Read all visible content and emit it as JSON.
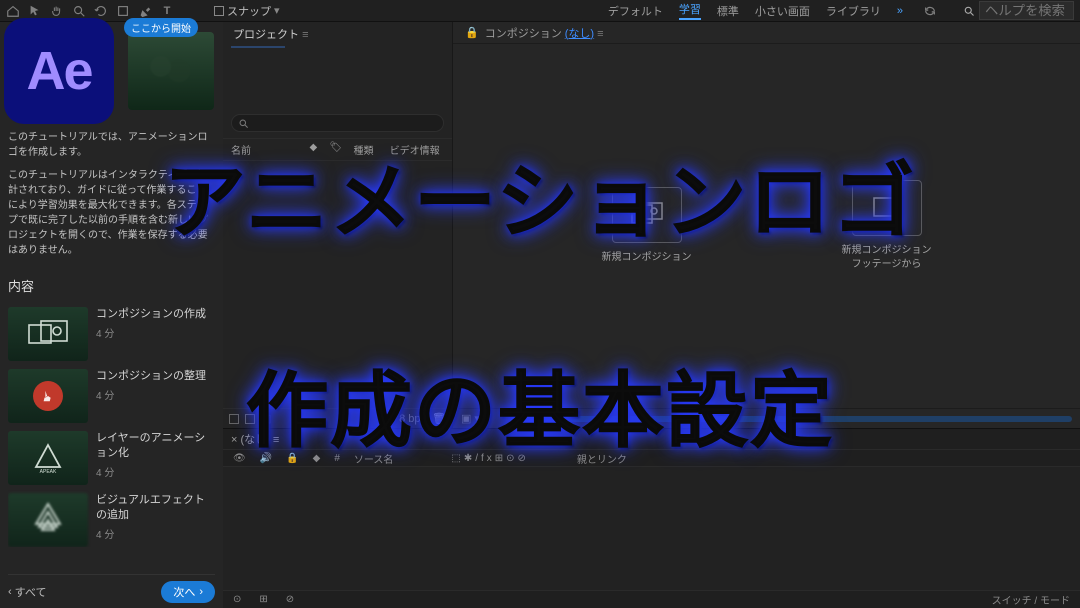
{
  "overlay": {
    "line1": "アニメーションロゴ",
    "line2": "作成の基本設定"
  },
  "topbar": {
    "snap_label": "スナップ",
    "workspaces": {
      "default": "デフォルト",
      "learn": "学習",
      "standard": "標準",
      "small": "小さい画面",
      "library": "ライブラリ"
    },
    "search_placeholder": "ヘルプを検索"
  },
  "logo": {
    "text": "Ae"
  },
  "tutorial": {
    "intro1": "このチュートリアルでは、アニメーションロゴを作成します。",
    "intro2": "このチュートリアルはインタラクティブに設計されており、ガイドに従って作業することにより学習効果を最大化できます。各ステップで既に完了した以前の手順を含む新しいプロジェクトを開くので、作業を保存する必要はありません。",
    "contents_label": "内容",
    "start_here": "ここから開始",
    "steps": [
      {
        "title": "コンポジションの作成",
        "duration": "4 分"
      },
      {
        "title": "コンポジションの整理",
        "duration": "4 分"
      },
      {
        "title": "レイヤーのアニメーション化",
        "duration": "4 分"
      },
      {
        "title": "ビジュアルエフェクトの追加",
        "duration": "4 分"
      }
    ],
    "all": "すべて",
    "next": "次へ"
  },
  "project": {
    "tab": "プロジェクト",
    "cols": {
      "name": "名前",
      "type": "種類",
      "video": "ビデオ情報"
    }
  },
  "comp": {
    "prefix": "コンポジション",
    "none": "(なし)",
    "new_comp": "新規コンポジション",
    "from_footage1": "新規コンポジション",
    "from_footage2": "フッテージから"
  },
  "timeline": {
    "tab": "(なし)",
    "source": "ソース名",
    "parent": "親とリンク",
    "switches": "スイッチ / モード"
  }
}
